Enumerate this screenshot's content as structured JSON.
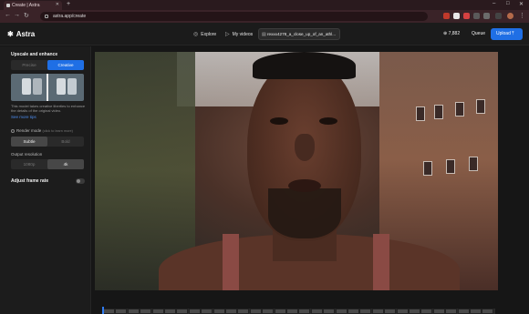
{
  "browser": {
    "tab_title": "Create | Astra",
    "new_tab": "+",
    "url": "astra.app/create",
    "window_controls": [
      "–",
      "□",
      "✕"
    ]
  },
  "header": {
    "logo": "Astra",
    "logo_symbol": "✱",
    "nav": [
      {
        "label": "Explore",
        "icon": "compass-icon",
        "glyph": "◎"
      },
      {
        "label": "My videos",
        "icon": "play-icon",
        "glyph": "▷"
      }
    ],
    "prompt_chip": "rexxx4278_a_close_up_of_an_athl...",
    "credits": "7,882",
    "queue": "Queue",
    "upload": "Upload"
  },
  "sidebar": {
    "section_title": "Upscale and enhance",
    "mode_options": [
      "Precise",
      "Creative"
    ],
    "mode_selected": "Creative",
    "description": "This model takes creative liberties to enhance the details of the original video.",
    "see_tips": "See more tips",
    "render_label": "Render mode",
    "render_hint": "(click to learn more)",
    "render_options": [
      "Subtle",
      "Bold"
    ],
    "render_selected": "Subtle",
    "output_label": "Output resolution",
    "output_options": [
      "1080p",
      "4k"
    ],
    "output_selected": "4k",
    "frame_rate_label": "Adjust frame rate",
    "frame_rate_on": false
  },
  "colors": {
    "accent": "#1f6fe5",
    "background": "#151515",
    "browser_chrome": "#3a2328"
  }
}
